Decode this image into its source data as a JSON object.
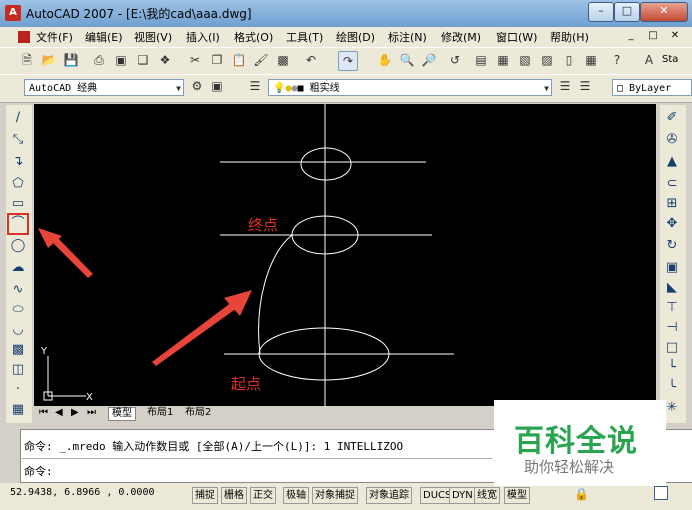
{
  "window": {
    "title": "AutoCAD 2007 - [E:\\我的cad\\aaa.dwg]",
    "app_icon": "A"
  },
  "menu": [
    "文件(F)",
    "编辑(E)",
    "视图(V)",
    "插入(I)",
    "格式(O)",
    "工具(T)",
    "绘图(D)",
    "标注(N)",
    "修改(M)",
    "窗口(W)",
    "帮助(H)"
  ],
  "toolbar2": {
    "workspace": "AutoCAD 经典",
    "layer": "粗实线",
    "linetype": "ByLayer",
    "style_label": "Sta"
  },
  "drawing": {
    "label_end": "终点",
    "label_start": "起点",
    "ucs_x": "X",
    "ucs_y": "Y"
  },
  "tabs": [
    "模型",
    "布局1",
    "布局2"
  ],
  "command": {
    "line1": "命令: _.mredo 输入动作数目或 [全部(A)/上一个(L)]: 1 INTELLIZOO",
    "line2": "命令:"
  },
  "status": {
    "coords": "52.9438, 6.8966 , 0.0000",
    "buttons": [
      "捕捉",
      "栅格",
      "正交",
      "极轴",
      "对象捕捉",
      "对象追踪",
      "DUCS",
      "DYN",
      "线宽",
      "模型"
    ]
  },
  "watermark": {
    "main": "百科全说",
    "sub": "助你轻松解决"
  },
  "colors": {
    "canvas": "#000000",
    "annotation": "#e03020",
    "arrow": "#e8453a",
    "geometry": "#ffffff"
  }
}
